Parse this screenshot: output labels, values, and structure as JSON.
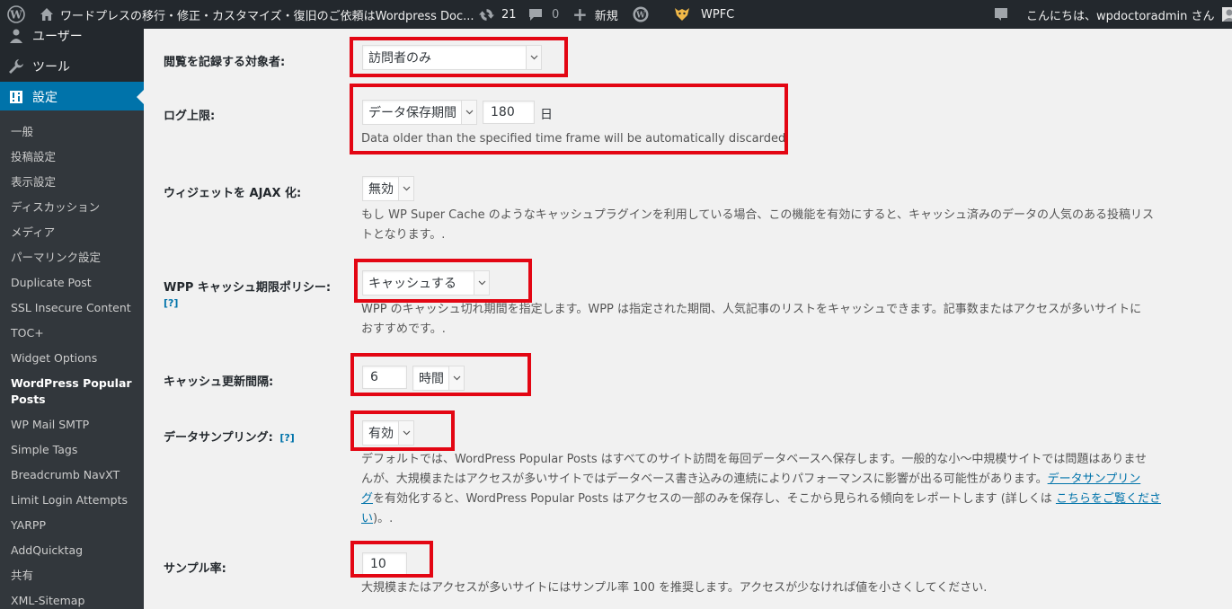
{
  "admin_bar": {
    "site_name": "ワードプレスの移行・修正・カスタマイズ・復旧のご依頼はWordpress Doc...",
    "updates_count": "21",
    "comments_count": "0",
    "new_label": "新規",
    "wpfc_label": "WPFC",
    "greeting": "こんにちは、wpdoctoradmin さん"
  },
  "sidebar": {
    "top_items": [
      {
        "label": "ユーザー",
        "icon": "users-icon"
      },
      {
        "label": "ツール",
        "icon": "wrench-icon"
      },
      {
        "label": "設定",
        "icon": "settings-icon"
      }
    ],
    "submenu": [
      "一般",
      "投稿設定",
      "表示設定",
      "ディスカッション",
      "メディア",
      "パーマリンク設定",
      "Duplicate Post",
      "SSL Insecure Content",
      "TOC+",
      "Widget Options",
      "WordPress Popular Posts",
      "WP Mail SMTP",
      "Simple Tags",
      "Breadcrumb NavXT",
      "Limit Login Attempts",
      "YARPP",
      "AddQuicktag",
      "共有",
      "XML-Sitemap"
    ]
  },
  "settings": {
    "log_target": {
      "label": "閲覧を記録する対象者:",
      "value": "訪問者のみ"
    },
    "log_limit": {
      "label": "ログ上限:",
      "select": "データ保存期間",
      "days": "180",
      "unit": "日",
      "desc": "Data older than the specified time frame will be automatically discarded."
    },
    "ajax_widget": {
      "label": "ウィジェットを AJAX 化:",
      "value": "無効",
      "desc1": "もし WP Super Cache のようなキャッシュプラグインを利用している場合、この機能を有効にすると、キャッシュ済みのデータの人気のある投稿リス",
      "desc2": "トとなります。."
    },
    "cache_policy": {
      "label": "WPP キャッシュ期限ポリシー:",
      "help": "[?]",
      "value": "キャッシュする",
      "desc1": "WPP のキャッシュ切れ期間を指定します。WPP は指定された期間、人気記事のリストをキャッシュできます。記事数またはアクセスが多いサイトに",
      "desc2": "おすすめです。."
    },
    "cache_interval": {
      "label": "キャッシュ更新間隔:",
      "value": "6",
      "unit": "時間"
    },
    "sampling": {
      "label": "データサンプリング:",
      "help": "[?]",
      "value": "有効",
      "desc1": "デフォルトでは、WordPress Popular Posts はすべてのサイト訪問を毎回データベースへ保存します。一般的な小～中規模サイトでは問題はありませ",
      "desc2a": "んが、大規模またはアクセスが多いサイトではデータベース書き込みの連続によりパフォーマンスに影響が出る可能性があります。",
      "desc2link": "データサンプリン",
      "desc3link": "グ",
      "desc3": "を有効化すると、WordPress Popular Posts はアクセスの一部のみを保存し、そこから見られる傾向をレポートします (詳しくは ",
      "desc3link2": "こちらをご覧くださ",
      "desc4link": "い",
      "desc4": ")。."
    },
    "sample_rate": {
      "label": "サンプル率:",
      "value": "10",
      "desc": "大規模またはアクセスが多いサイトにはサンプル率 100 を推奨します。アクセスが少なければ値を小さくしてください."
    }
  },
  "colors": {
    "highlight": "#e30613",
    "accent": "#0073aa",
    "adminbar": "#23282d"
  }
}
